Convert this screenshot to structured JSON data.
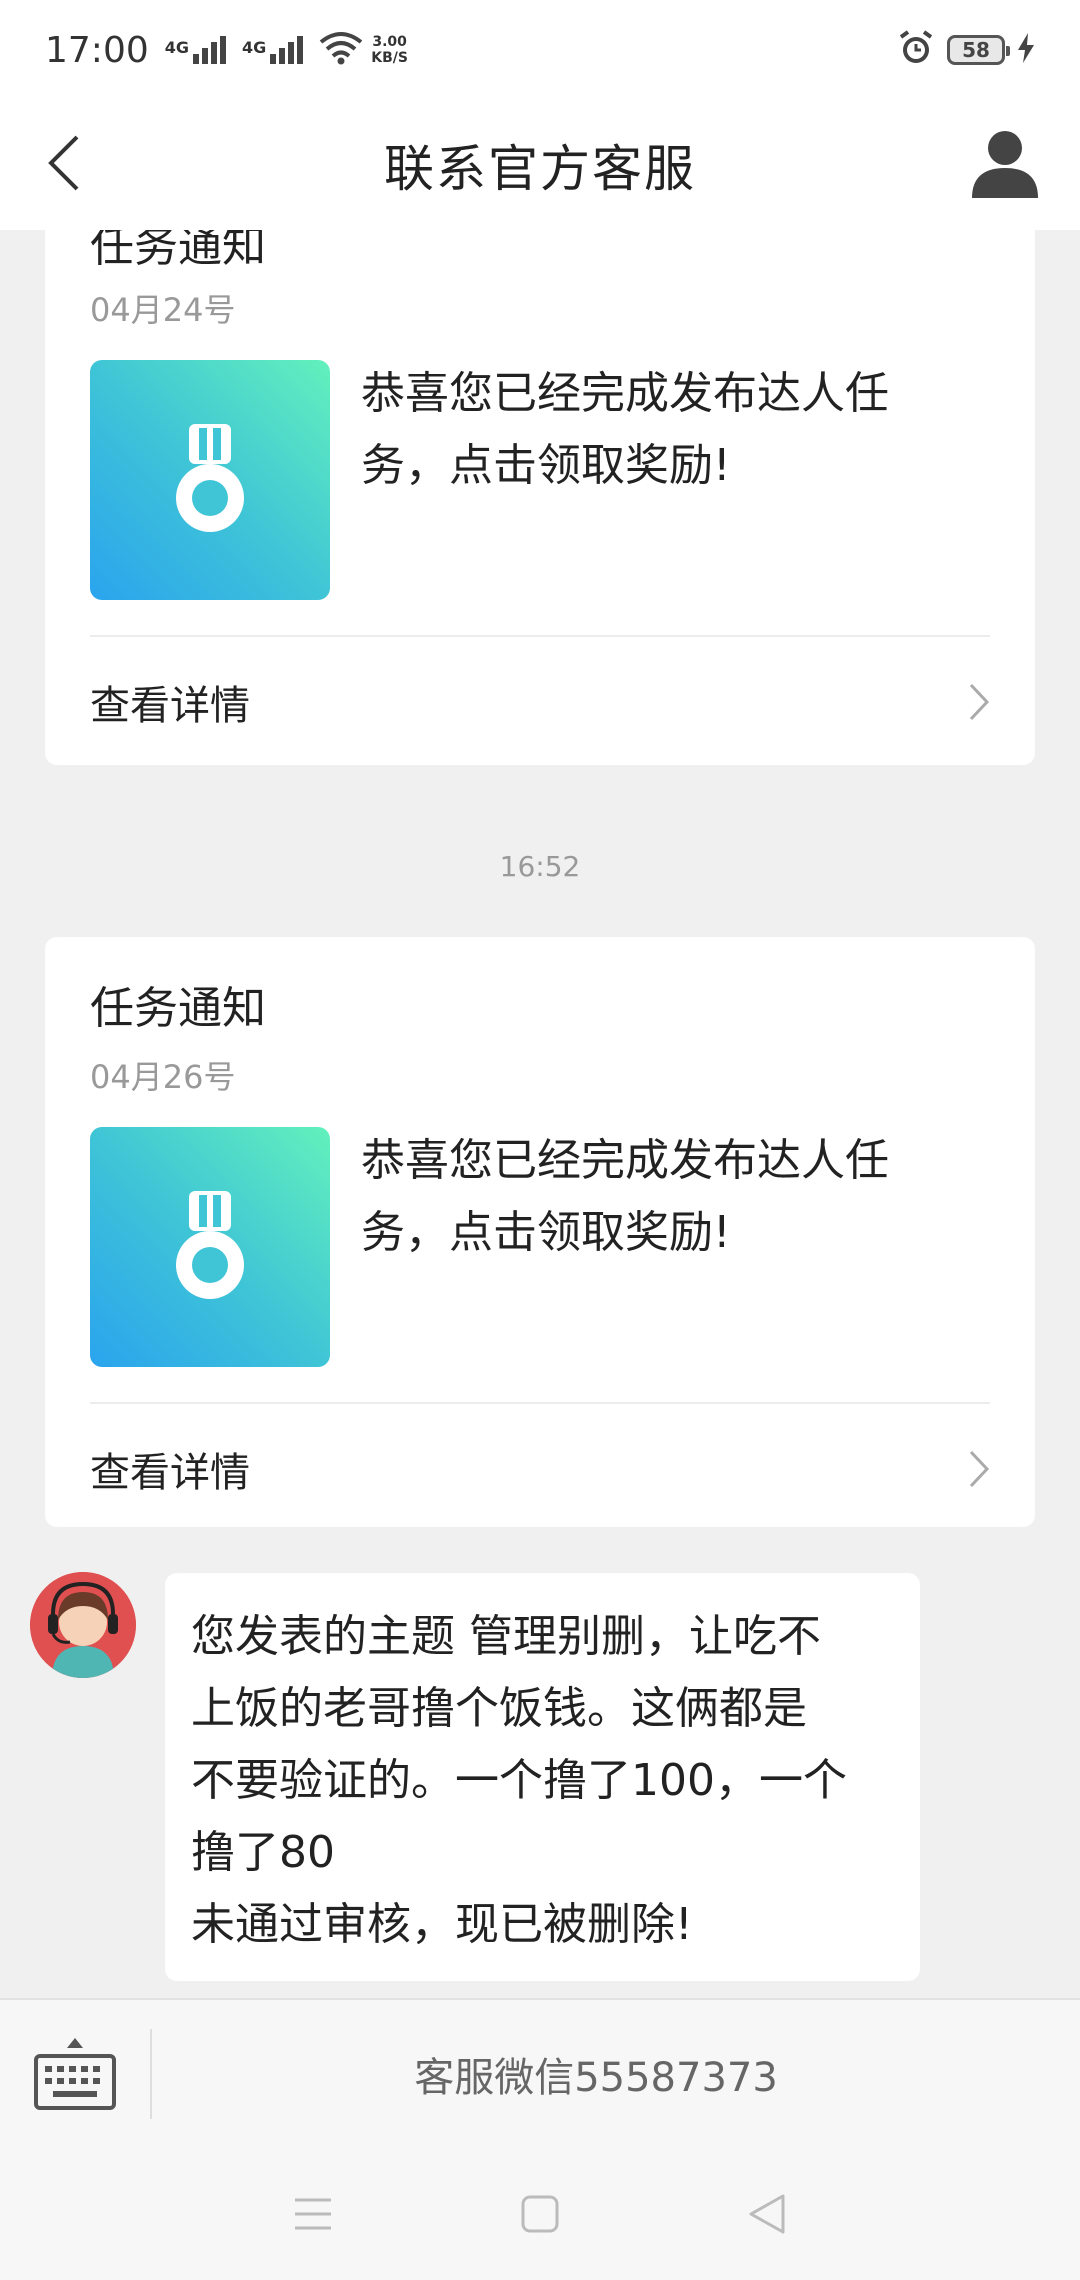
{
  "status_bar": {
    "time": "17:00",
    "signal1_label": "4G",
    "signal2_label": "4G",
    "net_speed_value": "3.00",
    "net_speed_unit": "KB/S",
    "battery_level": "58",
    "icons": [
      "signal-icon",
      "wifi-icon",
      "alarm-icon",
      "battery-icon",
      "charging-icon"
    ]
  },
  "header": {
    "title": "联系官方客服",
    "back_icon": "chevron-left-icon",
    "profile_icon": "user-icon"
  },
  "messages": {
    "card1": {
      "title": "任务通知",
      "date": "04月24号",
      "desc_line1": "恭喜您已经完成发布达人任",
      "desc_line2": "务，点击领取奖励!",
      "detail_label": "查看详情"
    },
    "time_divider": "16:52",
    "card2": {
      "title": "任务通知",
      "date": "04月26号",
      "desc_line1": "恭喜您已经完成发布达人任",
      "desc_line2": "务，点击领取奖励!",
      "detail_label": "查看详情"
    },
    "bubble": {
      "line1": "您发表的主题 管理别删，让吃不",
      "line2": "上饭的老哥撸个饭钱。这俩都是",
      "line3": "不要验证的。一个撸了100，一个",
      "line4": "撸了80",
      "line5": "未通过审核，现已被删除!"
    }
  },
  "input_bar": {
    "cs_wechat": "客服微信55587373",
    "keyboard_icon": "keyboard-icon"
  },
  "nav_bar": {
    "icons": [
      "menu-icon",
      "home-square-icon",
      "back-triangle-icon"
    ]
  },
  "colors": {
    "thumb_gradient_start": "#2aa4ee",
    "thumb_gradient_end": "#62f1bc",
    "avatar_bg": "#e05050",
    "background": "#f0f0f0"
  }
}
